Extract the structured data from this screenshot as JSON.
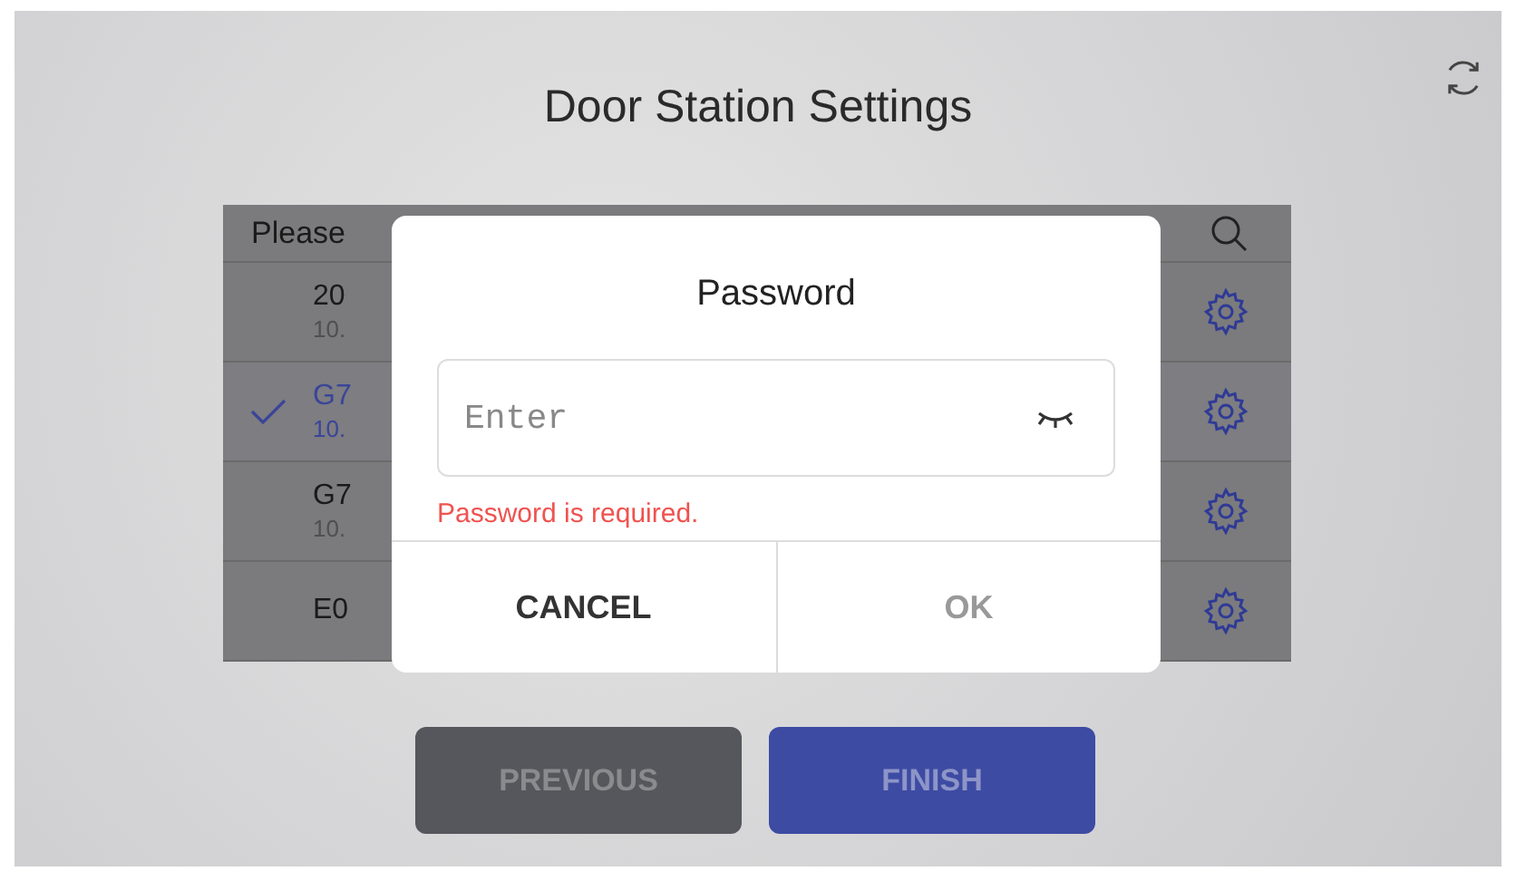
{
  "title": "Door Station Settings",
  "list": {
    "header": "Please",
    "devices": [
      {
        "name": "20",
        "ip": "10.",
        "selected": false
      },
      {
        "name": "G7",
        "ip": "10.",
        "selected": true
      },
      {
        "name": "G7",
        "ip": "10.",
        "selected": false
      },
      {
        "name": "E0",
        "selected": false
      }
    ]
  },
  "buttons": [
    {
      "label": "PREVIOUS",
      "kind": "secondary"
    },
    {
      "label": "FINISH",
      "kind": "primary"
    }
  ],
  "dialog": {
    "title": "Password",
    "field": {
      "placeholder": "Enter"
    },
    "error": "Password is required.",
    "actions": [
      {
        "label": "CANCEL",
        "disabled": false
      },
      {
        "label": "OK",
        "disabled": true
      }
    ]
  }
}
